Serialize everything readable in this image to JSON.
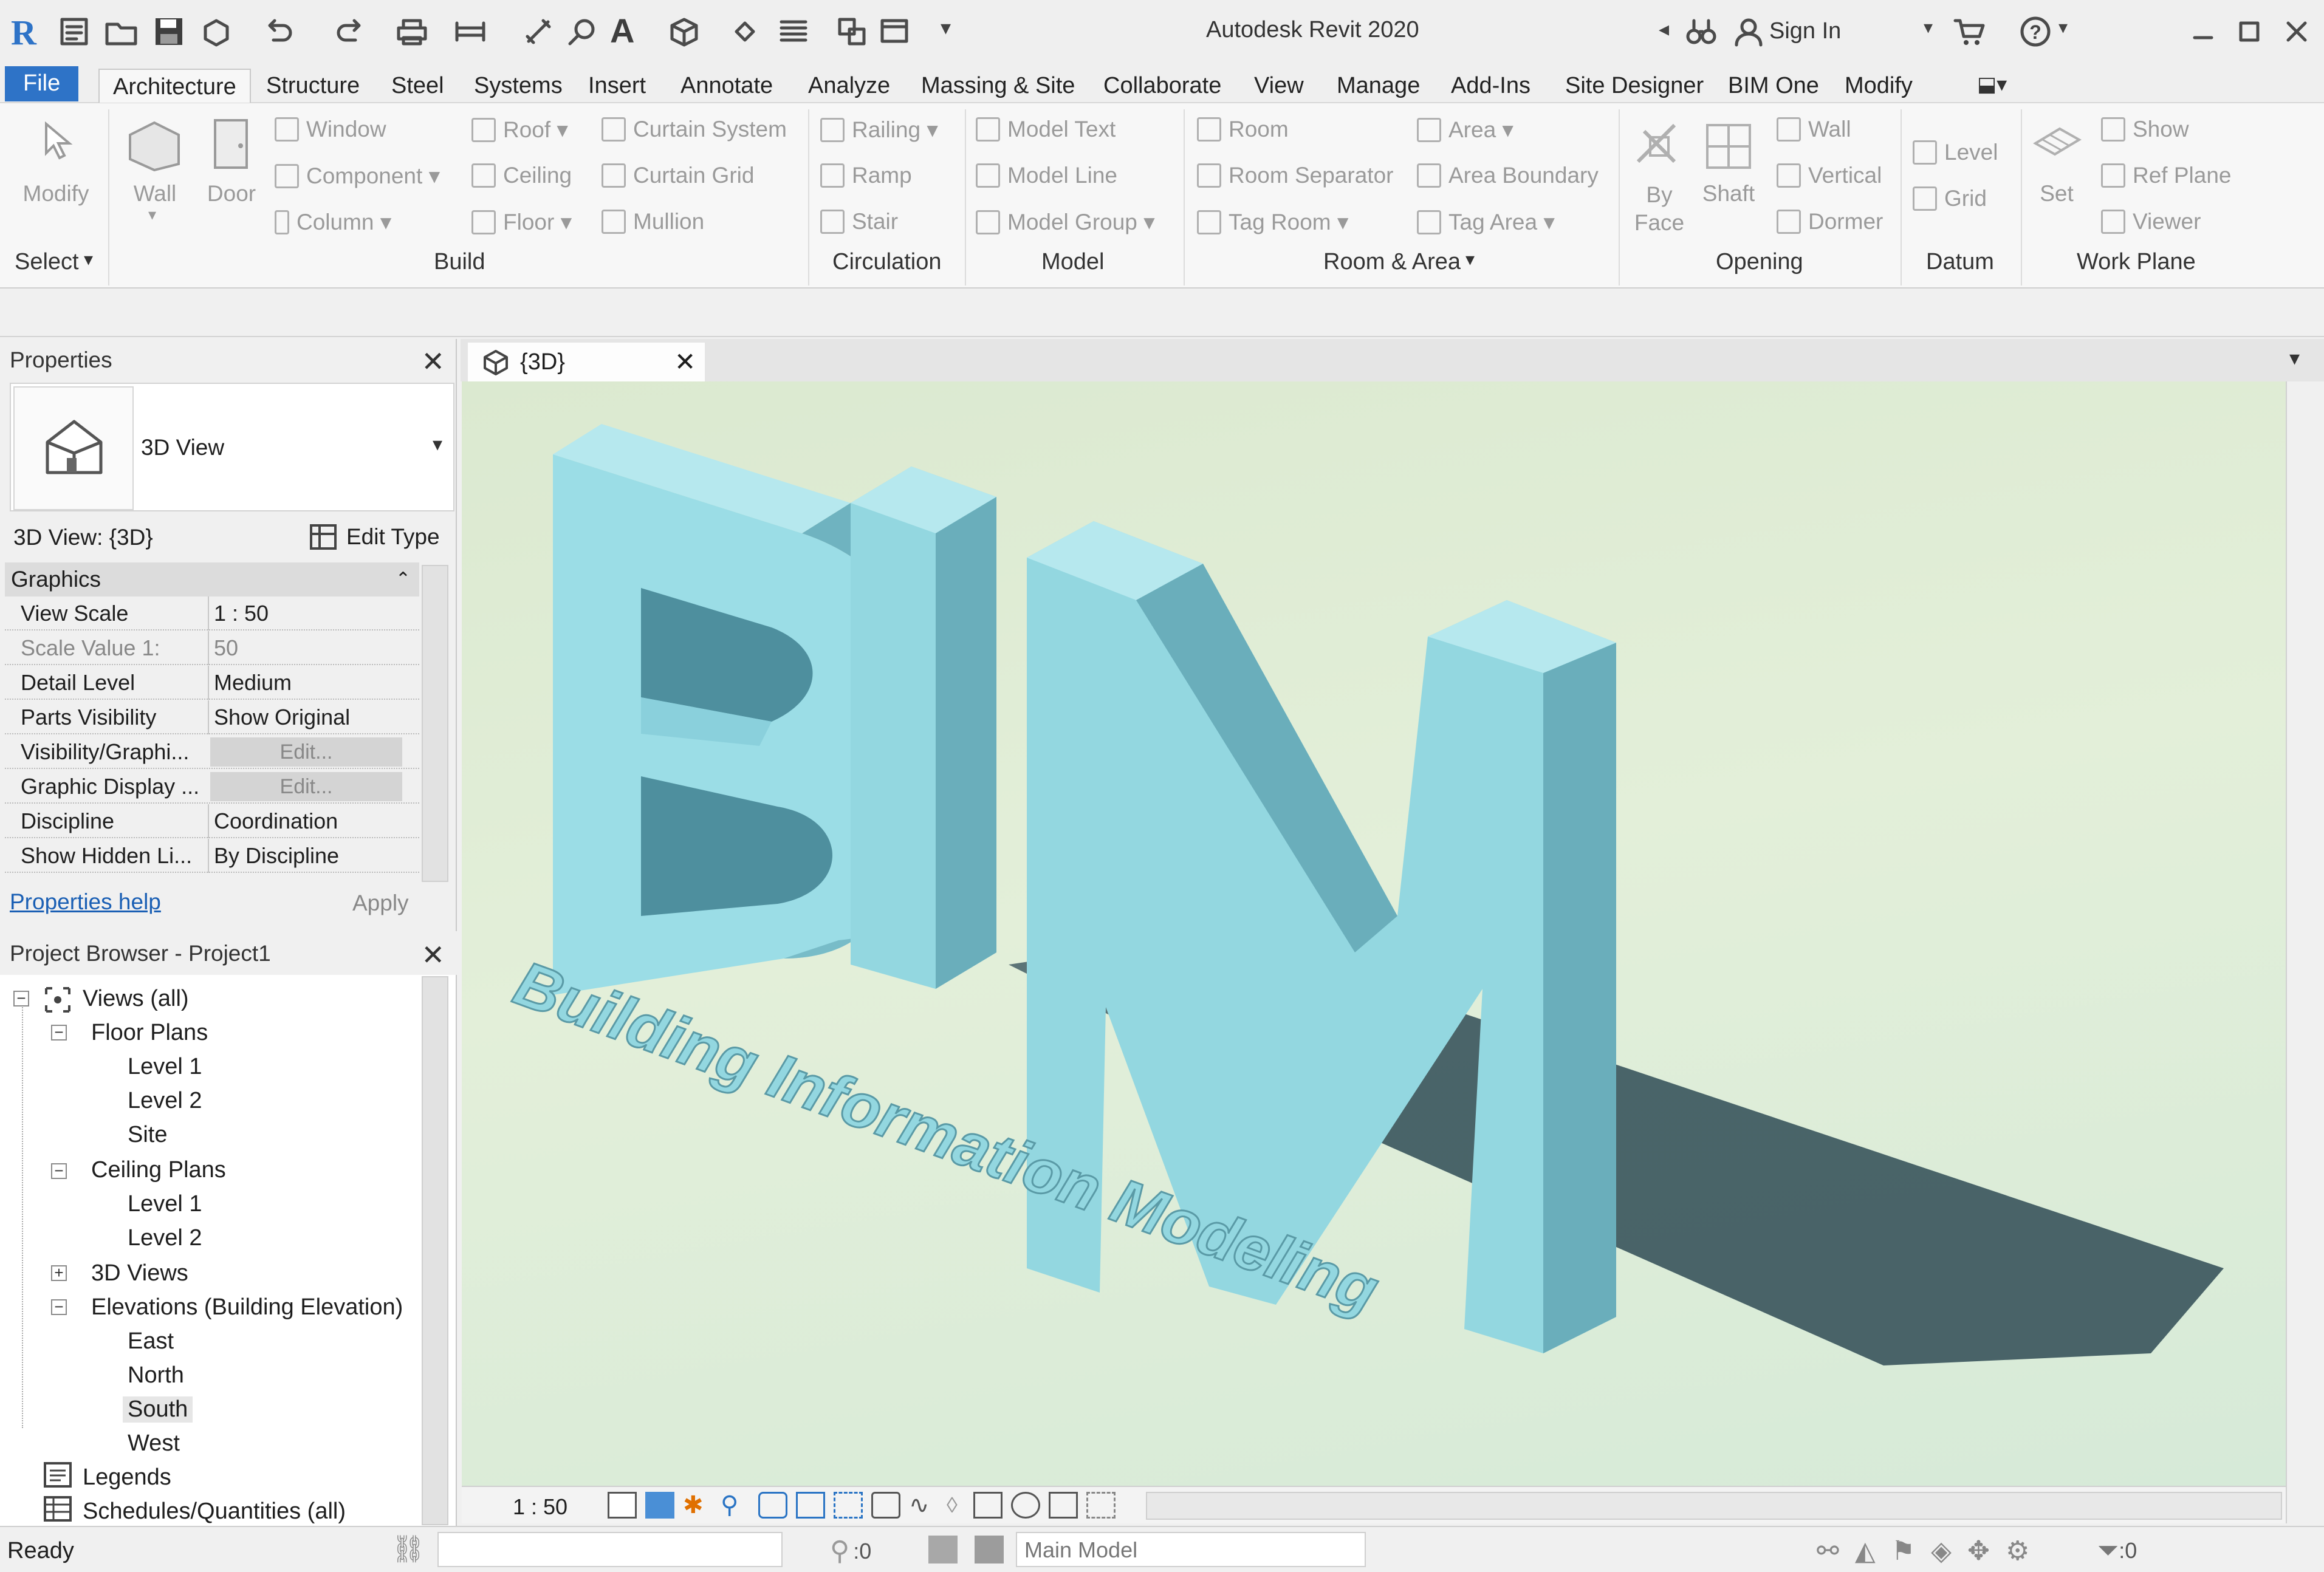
{
  "window": {
    "title": "Autodesk Revit 2020",
    "sign_in": "Sign In"
  },
  "ribbon_tabs": [
    "File",
    "Architecture",
    "Structure",
    "Steel",
    "Systems",
    "Insert",
    "Annotate",
    "Analyze",
    "Massing & Site",
    "Collaborate",
    "View",
    "Manage",
    "Add-Ins",
    "Site Designer",
    "BIM One",
    "Modify"
  ],
  "ribbon": {
    "select": {
      "modify": "Modify",
      "label": "Select"
    },
    "build": {
      "label": "Build",
      "wall": "Wall",
      "door": "Door",
      "window": "Window",
      "component": "Component",
      "column": "Column",
      "roof": "Roof",
      "ceiling": "Ceiling",
      "floor": "Floor",
      "curtain_system": "Curtain System",
      "curtain_grid": "Curtain Grid",
      "mullion": "Mullion"
    },
    "circulation": {
      "label": "Circulation",
      "railing": "Railing",
      "ramp": "Ramp",
      "stair": "Stair"
    },
    "model": {
      "label": "Model",
      "model_text": "Model Text",
      "model_line": "Model Line",
      "model_group": "Model Group"
    },
    "room_area": {
      "label": "Room & Area",
      "room": "Room",
      "room_separator": "Room Separator",
      "tag_room": "Tag Room",
      "area": "Area",
      "area_boundary": "Area Boundary",
      "tag_area": "Tag Area"
    },
    "opening": {
      "label": "Opening",
      "by_face_1": "By",
      "by_face_2": "Face",
      "shaft": "Shaft",
      "wall": "Wall",
      "vertical": "Vertical",
      "dormer": "Dormer"
    },
    "datum": {
      "label": "Datum",
      "level": "Level",
      "grid": "Grid"
    },
    "work_plane": {
      "label": "Work Plane",
      "set": "Set",
      "show": "Show",
      "ref_plane": "Ref Plane",
      "viewer": "Viewer"
    }
  },
  "properties": {
    "title": "Properties",
    "type_name": "3D View",
    "instance": "3D View: {3D}",
    "edit_type": "Edit Type",
    "section": "Graphics",
    "rows": [
      {
        "key": "View Scale",
        "value": "1 : 50"
      },
      {
        "key": "Scale Value    1:",
        "value": "50"
      },
      {
        "key": "Detail Level",
        "value": "Medium"
      },
      {
        "key": "Parts Visibility",
        "value": "Show Original"
      },
      {
        "key": "Visibility/Graphi...",
        "value": "Edit..."
      },
      {
        "key": "Graphic Display ...",
        "value": "Edit..."
      },
      {
        "key": "Discipline",
        "value": "Coordination"
      },
      {
        "key": "Show Hidden Li...",
        "value": "By Discipline"
      }
    ],
    "help_link": "Properties help",
    "apply": "Apply"
  },
  "project_browser": {
    "title": "Project Browser - Project1",
    "views_all": "Views (all)",
    "floor_plans": "Floor Plans",
    "floor_items": [
      "Level 1",
      "Level 2",
      "Site"
    ],
    "ceiling_plans": "Ceiling Plans",
    "ceiling_items": [
      "Level 1",
      "Level 2"
    ],
    "views_3d": "3D Views",
    "elevations": "Elevations (Building Elevation)",
    "elevation_items": [
      "East",
      "North",
      "South",
      "West"
    ],
    "legends": "Legends",
    "schedules": "Schedules/Quantities (all)"
  },
  "view_tab": {
    "label": "{3D}"
  },
  "model_text": {
    "big": "BIM",
    "sub": "Building Information Modeling",
    "color": "#93d7e0"
  },
  "view_control": {
    "scale": "1 : 50"
  },
  "status": {
    "ready": "Ready",
    "zero1": ":0",
    "workset": "Main Model",
    "filter": ":0"
  },
  "colors": {
    "file_tab": "#2e73c7",
    "link": "#1a5fb4"
  }
}
